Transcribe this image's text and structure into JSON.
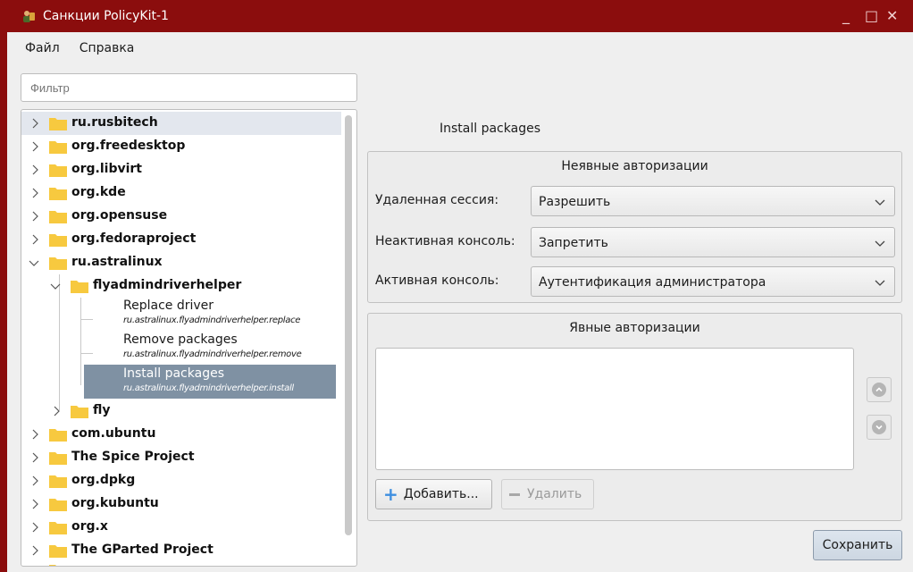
{
  "window": {
    "title": "Санкции PolicyKit-1",
    "controls": {
      "minimize": "_",
      "maximize": "□",
      "close": "✕"
    }
  },
  "menu": [
    {
      "label": "Файл"
    },
    {
      "label": "Справка"
    }
  ],
  "filter": {
    "placeholder": "Фильтр",
    "value": ""
  },
  "tree": {
    "top_nodes": [
      {
        "label": "ru.rusbitech",
        "expanded": false,
        "highlighted": true
      },
      {
        "label": "org.freedesktop",
        "expanded": false
      },
      {
        "label": "org.libvirt",
        "expanded": false
      },
      {
        "label": "org.kde",
        "expanded": false
      },
      {
        "label": "org.opensuse",
        "expanded": false
      },
      {
        "label": "org.fedoraproject",
        "expanded": false
      },
      {
        "label": "ru.astralinux",
        "expanded": true
      }
    ],
    "astra_child": {
      "label": "flyadmindriverhelper",
      "expanded": true
    },
    "actions": [
      {
        "title": "Replace driver",
        "id": "ru.astralinux.flyadmindriverhelper.replace",
        "selected": false
      },
      {
        "title": "Remove packages",
        "id": "ru.astralinux.flyadmindriverhelper.remove",
        "selected": false
      },
      {
        "title": "Install packages",
        "id": "ru.astralinux.flyadmindriverhelper.install",
        "selected": true
      }
    ],
    "astra_child2": {
      "label": "fly",
      "expanded": false
    },
    "bottom_nodes": [
      {
        "label": "com.ubuntu"
      },
      {
        "label": "The Spice Project"
      },
      {
        "label": "org.dpkg"
      },
      {
        "label": "org.kubuntu"
      },
      {
        "label": "org.x"
      },
      {
        "label": "The GParted Project"
      }
    ]
  },
  "details": {
    "action_title": "Install packages",
    "implicit": {
      "title": "Неявные авторизации",
      "rows": [
        {
          "label": "Удаленная сессия:",
          "value": "Разрешить"
        },
        {
          "label": "Неактивная консоль:",
          "value": "Запретить"
        },
        {
          "label": "Активная консоль:",
          "value": "Аутентификация администратора"
        }
      ]
    },
    "explicit": {
      "title": "Явные авторизации",
      "add_label": "Добавить...",
      "remove_label": "Удалить"
    },
    "save_label": "Сохранить"
  },
  "colors": {
    "titlebar": "#8b0d0d",
    "selection": "#7f91a3",
    "folder": "#f7c93f"
  }
}
